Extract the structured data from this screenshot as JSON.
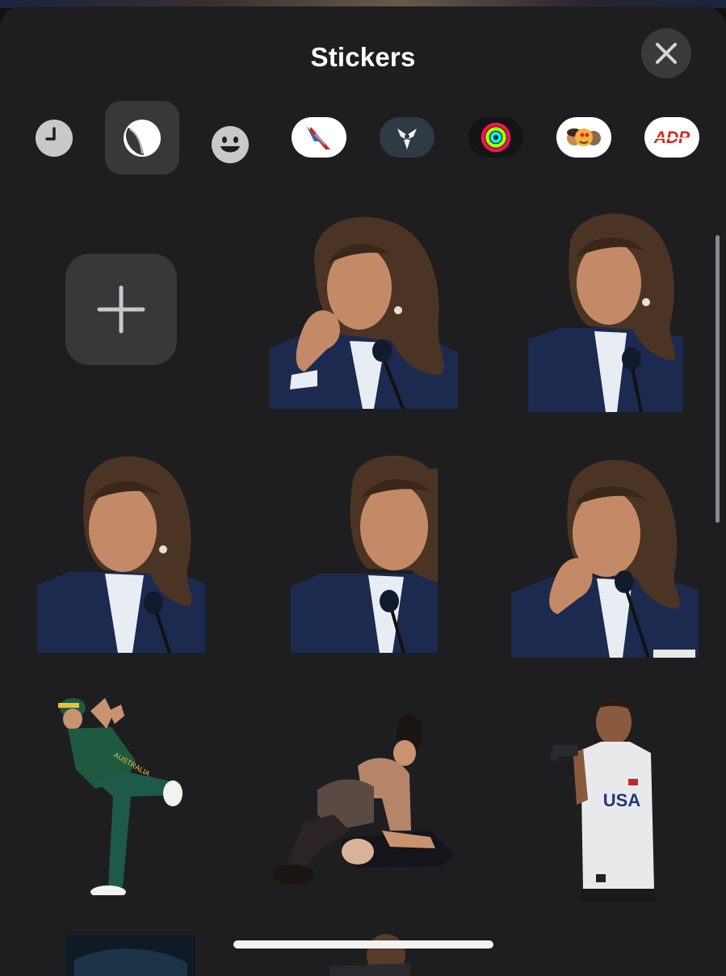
{
  "header": {
    "title": "Stickers",
    "close_icon": "xmark-icon"
  },
  "categories": [
    {
      "name": "recents",
      "icon": "clock-icon",
      "selected": false
    },
    {
      "name": "my-stickers",
      "icon": "sticker-peel-icon",
      "selected": true
    },
    {
      "name": "emoji",
      "icon": "smiley-icon",
      "selected": false
    },
    {
      "name": "american-airlines",
      "icon": "american-airlines-logo",
      "selected": false
    },
    {
      "name": "destiny",
      "icon": "destiny-logo",
      "selected": false
    },
    {
      "name": "activity",
      "icon": "activity-rings-icon",
      "selected": false
    },
    {
      "name": "memoji",
      "icon": "memoji-icon",
      "selected": false
    },
    {
      "name": "adp",
      "icon": "adp-logo",
      "selected": false
    }
  ],
  "adp_logo_text": "ADP",
  "add_sticker": {
    "icon": "plus-icon"
  },
  "stickers": [
    {
      "name": "sticker-woman-debate-1"
    },
    {
      "name": "sticker-woman-debate-2"
    },
    {
      "name": "sticker-woman-debate-3"
    },
    {
      "name": "sticker-woman-debate-4"
    },
    {
      "name": "sticker-woman-debate-5"
    },
    {
      "name": "sticker-breakdancer"
    },
    {
      "name": "sticker-wrestlers"
    },
    {
      "name": "sticker-usa-shirt-man"
    }
  ],
  "sticker_texts": {
    "usa_shirt": "USA",
    "breakdancer_shirt": "AUSTRALIA"
  },
  "colors": {
    "sheet_bg": "#1e1e20",
    "tile_bg": "#38383b",
    "accent_red": "#d0271d"
  }
}
